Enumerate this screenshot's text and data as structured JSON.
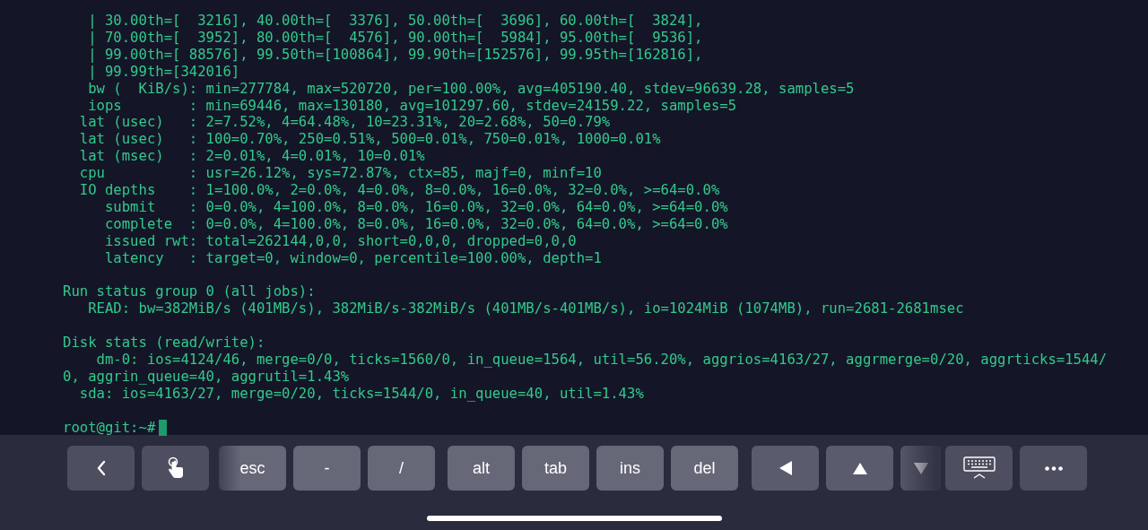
{
  "terminal": {
    "blocks": [
      {
        "lines": [
          "   | 30.00th=[  3216], 40.00th=[  3376], 50.00th=[  3696], 60.00th=[  3824],",
          "   | 70.00th=[  3952], 80.00th=[  4576], 90.00th=[  5984], 95.00th=[  9536],",
          "   | 99.00th=[ 88576], 99.50th=[100864], 99.90th=[152576], 99.95th=[162816],",
          "   | 99.99th=[342016]",
          "   bw (  KiB/s): min=277784, max=520720, per=100.00%, avg=405190.40, stdev=96639.28, samples=5",
          "   iops        : min=69446, max=130180, avg=101297.60, stdev=24159.22, samples=5",
          "  lat (usec)   : 2=7.52%, 4=64.48%, 10=23.31%, 20=2.68%, 50=0.79%",
          "  lat (usec)   : 100=0.70%, 250=0.51%, 500=0.01%, 750=0.01%, 1000=0.01%",
          "  lat (msec)   : 2=0.01%, 4=0.01%, 10=0.01%",
          "  cpu          : usr=26.12%, sys=72.87%, ctx=85, majf=0, minf=10",
          "  IO depths    : 1=100.0%, 2=0.0%, 4=0.0%, 8=0.0%, 16=0.0%, 32=0.0%, >=64=0.0%",
          "     submit    : 0=0.0%, 4=100.0%, 8=0.0%, 16=0.0%, 32=0.0%, 64=0.0%, >=64=0.0%",
          "     complete  : 0=0.0%, 4=100.0%, 8=0.0%, 16=0.0%, 32=0.0%, 64=0.0%, >=64=0.0%",
          "     issued rwt: total=262144,0,0, short=0,0,0, dropped=0,0,0",
          "     latency   : target=0, window=0, percentile=100.00%, depth=1"
        ]
      },
      {
        "lines": [
          "Run status group 0 (all jobs):",
          "   READ: bw=382MiB/s (401MB/s), 382MiB/s-382MiB/s (401MB/s-401MB/s), io=1024MiB (1074MB), run=2681-2681msec"
        ]
      },
      {
        "lines": [
          "Disk stats (read/write):",
          "    dm-0: ios=4124/46, merge=0/0, ticks=1560/0, in_queue=1564, util=56.20%, aggrios=4163/27, aggrmerge=0/20, aggrticks=1544/",
          "0, aggrin_queue=40, aggrutil=1.43%",
          "  sda: ios=4163/27, merge=0/20, ticks=1544/0, in_queue=40, util=1.43%"
        ]
      }
    ],
    "prompt": "root@git:~#"
  },
  "keyboard_bar": {
    "left_keys": [
      {
        "kind": "back"
      },
      {
        "kind": "touch"
      }
    ],
    "keys": [
      {
        "kind": "text",
        "label": "esc"
      },
      {
        "kind": "text",
        "label": "-"
      },
      {
        "kind": "text",
        "label": "/"
      },
      {
        "kind": "text",
        "label": "alt"
      },
      {
        "kind": "text",
        "label": "tab"
      },
      {
        "kind": "text",
        "label": "ins"
      },
      {
        "kind": "text",
        "label": "del"
      },
      {
        "kind": "left"
      },
      {
        "kind": "up"
      },
      {
        "kind": "down"
      }
    ],
    "right_keys": [
      {
        "kind": "keyboard"
      },
      {
        "kind": "more"
      }
    ]
  }
}
